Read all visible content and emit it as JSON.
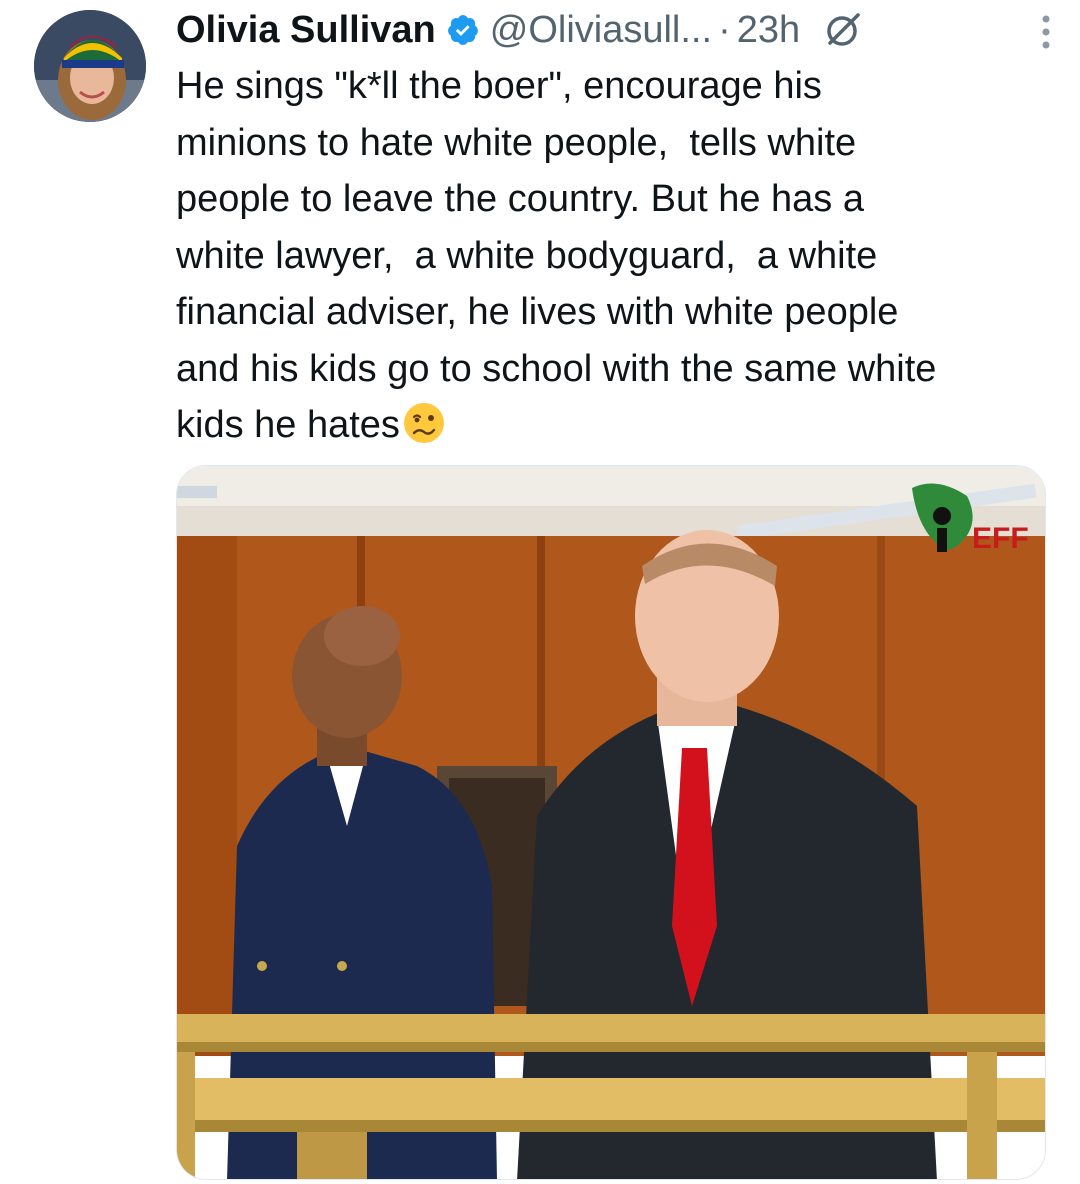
{
  "tweet": {
    "author_name": "Olivia Sullivan",
    "handle": "@Oliviasull...",
    "separator": "·",
    "time": "23h",
    "verified": true,
    "icons": {
      "verified": "verified-badge-icon",
      "grok": "grok-icon",
      "more": "more-options-icon",
      "emoji": "woozy-face-emoji"
    },
    "text": "He sings \"k*ll the boer\", encourage his\nminions to hate white people,  tells white\npeople to leave the country. But he has a\nwhite lawyer,  a white bodyguard,  a white\nfinancial adviser, he lives with white people\nand his kids go to school with the same white\nkids he hates",
    "media": {
      "watermark": "EFF"
    }
  },
  "colors": {
    "text": "#0f1419",
    "secondary": "#536471",
    "verified_blue": "#1d9bf0"
  }
}
